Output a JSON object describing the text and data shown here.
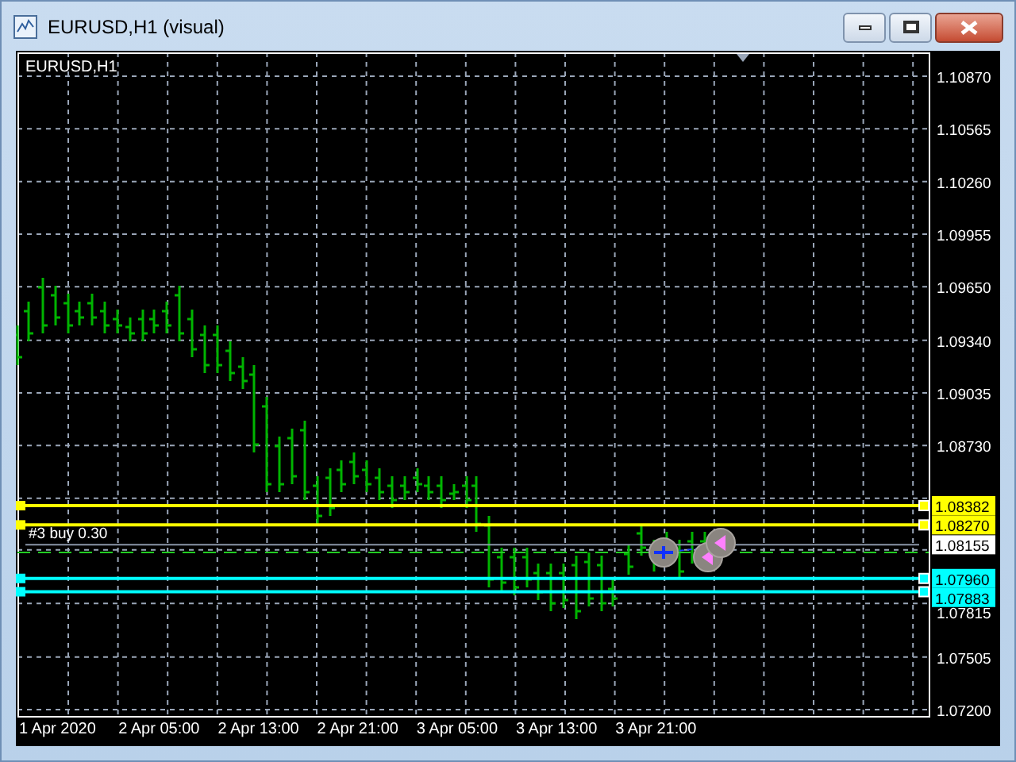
{
  "window": {
    "title": "EURUSD,H1 (visual)"
  },
  "chart": {
    "symbol_label": "EURUSD,H1",
    "price_labels": [
      "1.10870",
      "1.10565",
      "1.10260",
      "1.09955",
      "1.09650",
      "1.09340",
      "1.09035",
      "1.08730",
      "1.07815",
      "1.07505",
      "1.07200"
    ],
    "time_labels": [
      "1 Apr 2020",
      "2 Apr 05:00",
      "2 Apr 13:00",
      "2 Apr 21:00",
      "3 Apr 05:00",
      "3 Apr 13:00",
      "3 Apr 21:00"
    ],
    "levels": [
      {
        "price": "1.08382",
        "kind": "handle",
        "color": "#ffff00"
      },
      {
        "price": "1.08270",
        "kind": "handle",
        "color": "#ffff00"
      },
      {
        "price": "1.08155",
        "kind": "plain",
        "color": "#ffffff"
      },
      {
        "price": "1.07960",
        "kind": "handle",
        "color": "#00ffff"
      },
      {
        "price": "1.07883",
        "kind": "handle",
        "color": "#00ffff"
      }
    ],
    "order_label": "#3 buy 0.30"
  }
}
